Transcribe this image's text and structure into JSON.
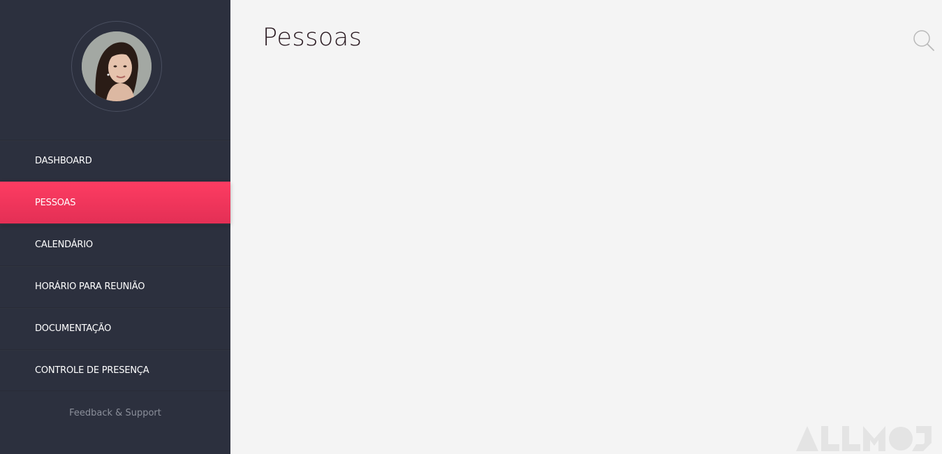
{
  "sidebar": {
    "avatar_alt": "User avatar",
    "items": [
      {
        "label": "DASHBOARD"
      },
      {
        "label": "PESSOAS"
      },
      {
        "label": "CALENDÁRIO"
      },
      {
        "label": "HORÁRIO PARA REUNIÃO"
      },
      {
        "label": "DOCUMENTAÇÃO"
      },
      {
        "label": "CONTROLE DE PRESENÇA"
      }
    ],
    "active_index": 1,
    "feedback_label": "Feedback & Support"
  },
  "main": {
    "title": "Pessoas"
  },
  "icons": {
    "search": "search-icon",
    "watermark": "allmoj-logo"
  },
  "colors": {
    "sidebar_bg": "#2c303e",
    "accent": "#fd3c62",
    "main_bg": "#f4f4f4",
    "title": "#2b1b22"
  },
  "watermark_text": "ALLMOJ"
}
